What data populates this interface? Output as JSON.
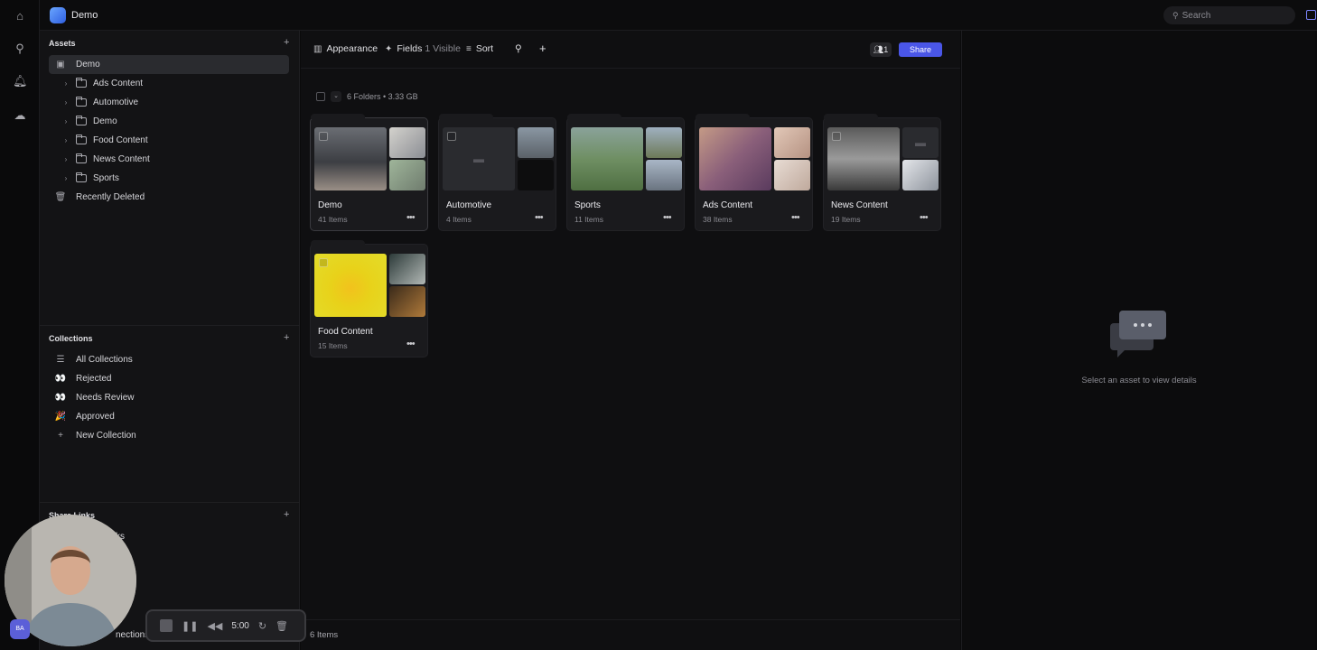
{
  "app": {
    "title": "Demo"
  },
  "search": {
    "placeholder": "Search"
  },
  "sidebar": {
    "assets_heading": "Assets",
    "tree": [
      {
        "label": "Demo",
        "selected": true
      },
      {
        "label": "Ads Content"
      },
      {
        "label": "Automotive"
      },
      {
        "label": "Demo"
      },
      {
        "label": "Food Content"
      },
      {
        "label": "News Content"
      },
      {
        "label": "Sports"
      }
    ],
    "recently_deleted": "Recently Deleted",
    "collections_heading": "Collections",
    "collections": [
      {
        "label": "All Collections",
        "icon": "list-icon"
      },
      {
        "label": "Rejected",
        "icon": "eyes-icon"
      },
      {
        "label": "Needs Review",
        "icon": "eyes-icon"
      },
      {
        "label": "Approved",
        "icon": "party-icon"
      },
      {
        "label": "New Collection",
        "icon": "plus-icon"
      }
    ],
    "share_links_heading": "Share Links",
    "share_links_item": "ks",
    "bottom_item": "nections",
    "avatar_initials": "BA"
  },
  "toolbar": {
    "appearance": "Appearance",
    "fields": "Fields",
    "fields_visible": "1 Visible",
    "sort": "Sort",
    "people_count": "1",
    "share": "Share"
  },
  "main": {
    "summary": "6 Folders • 3.33 GB",
    "footer_count": "6 Items",
    "folders": [
      {
        "title": "Demo",
        "count": "41 Items"
      },
      {
        "title": "Automotive",
        "count": "4 Items"
      },
      {
        "title": "Sports",
        "count": "11 Items"
      },
      {
        "title": "Ads Content",
        "count": "38 Items"
      },
      {
        "title": "News Content",
        "count": "19 Items"
      },
      {
        "title": "Food Content",
        "count": "15 Items"
      }
    ]
  },
  "details": {
    "empty_text": "Select an asset to view details"
  },
  "recorder": {
    "time": "5:00"
  },
  "colors": {
    "accent": "#4a56e8",
    "selected_row": "#2a2b2f"
  }
}
